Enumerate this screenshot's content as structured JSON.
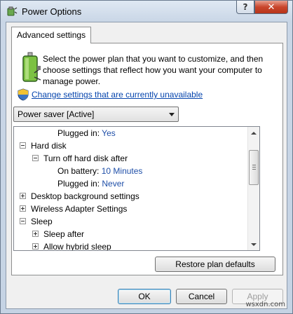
{
  "window": {
    "title": "Power Options",
    "help_glyph": "?",
    "close_glyph": "✕"
  },
  "tab": {
    "label": "Advanced settings"
  },
  "intro_text": "Select the power plan that you want to customize, and then choose settings that reflect how you want your computer to manage power.",
  "change_settings_link": "Change settings that are currently unavailable",
  "plan_dropdown": {
    "selected": "Power saver [Active]"
  },
  "tree": {
    "rows": [
      {
        "label": "Plugged in:",
        "value": "Yes"
      },
      {
        "label": "Hard disk"
      },
      {
        "label": "Turn off hard disk after"
      },
      {
        "label": "On battery:",
        "value": "10 Minutes"
      },
      {
        "label": "Plugged in:",
        "value": "Never"
      },
      {
        "label": "Desktop background settings"
      },
      {
        "label": "Wireless Adapter Settings"
      },
      {
        "label": "Sleep"
      },
      {
        "label": "Sleep after"
      },
      {
        "label": "Allow hybrid sleep"
      }
    ]
  },
  "buttons": {
    "restore": "Restore plan defaults",
    "ok": "OK",
    "cancel": "Cancel",
    "apply": "Apply"
  },
  "watermark": "wsxdn.com",
  "colors": {
    "link": "#0645ad",
    "setting_value": "#1f4fa8",
    "close_button": "#c9462c"
  },
  "icons": {
    "app": "power-options-icon",
    "battery": "battery-plug-icon",
    "shield": "uac-shield-icon"
  }
}
